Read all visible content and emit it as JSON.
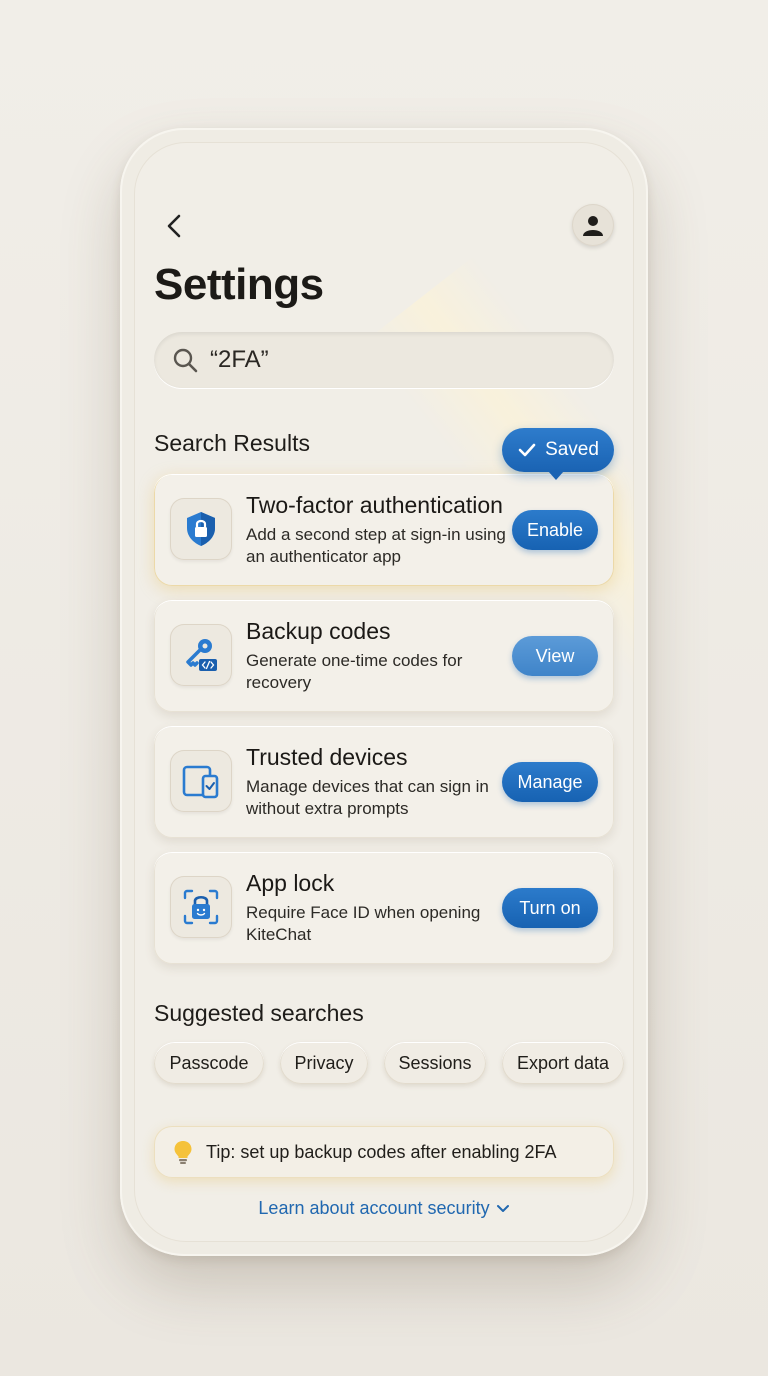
{
  "header": {
    "title": "Settings",
    "back_icon": "chevron-left-icon",
    "avatar_icon": "person-icon"
  },
  "search": {
    "value": "“2FA”"
  },
  "results": {
    "title": "Search Results",
    "saved_toast": "Saved",
    "items": [
      {
        "title": "Two-factor authentication",
        "description": "Add a second step at sign-in using an authenticator app",
        "action": "Enable",
        "icon": "shield-lock-icon"
      },
      {
        "title": "Backup codes",
        "description": "Generate one-time codes for recovery",
        "action": "View",
        "icon": "key-code-icon"
      },
      {
        "title": "Trusted devices",
        "description": "Manage devices that can sign in without extra prompts",
        "action": "Manage",
        "icon": "devices-icon"
      },
      {
        "title": "App lock",
        "description": "Require Face ID when opening KiteChat",
        "action": "Turn on",
        "icon": "face-lock-icon"
      }
    ]
  },
  "suggested": {
    "title": "Suggested searches",
    "chips": [
      "Passcode",
      "Privacy",
      "Sessions",
      "Export data"
    ]
  },
  "tip": {
    "icon": "lightbulb-icon",
    "text": "Tip: set up backup codes after enabling 2FA"
  },
  "learn_more": {
    "text": "Learn about account security"
  },
  "colors": {
    "accent": "#1a63b3",
    "background": "#f1eee7"
  }
}
